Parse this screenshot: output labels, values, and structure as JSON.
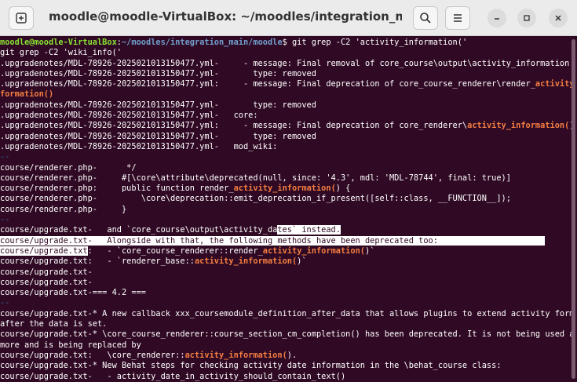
{
  "window": {
    "title": "moodle@moodle-VirtualBox: ~/moodles/integration_main/...",
    "icons": [
      "new-tab-icon",
      "search-icon",
      "menu-icon",
      "minimize-icon",
      "maximize-icon",
      "close-icon"
    ]
  },
  "prompt": {
    "user": "moodle@moodle-VirtualBox",
    "sep": ":",
    "path": "~/moodles/integration_main/moodle",
    "dollar": "$ ",
    "command": "git grep -C2 'activity_information('",
    "wrapped": "git grep -C2 'wiki_info('"
  },
  "lines": [
    {
      "s": [
        {
          "t": ".upgradenotes/MDL-78926-2025021013150477.yml-     - message: Final removal of core_course\\output\\activity_information"
        }
      ]
    },
    {
      "s": [
        {
          "t": ".upgradenotes/MDL-78926-2025021013150477.yml-       type: removed"
        }
      ]
    },
    {
      "s": [
        {
          "t": ".upgradenotes/MDL-78926-2025021013150477.yml:     - message: Final deprecation of core_course_renderer\\render_"
        },
        {
          "t": "activity_in",
          "c": "m"
        }
      ]
    },
    {
      "s": [
        {
          "t": "formation()",
          "c": "m"
        }
      ]
    },
    {
      "s": [
        {
          "t": ".upgradenotes/MDL-78926-2025021013150477.yml-       type: removed"
        }
      ]
    },
    {
      "s": [
        {
          "t": ".upgradenotes/MDL-78926-2025021013150477.yml-   core:"
        }
      ]
    },
    {
      "s": [
        {
          "t": ".upgradenotes/MDL-78926-2025021013150477.yml:     - message: Final deprecation of core_renderer\\"
        },
        {
          "t": "activity_information(",
          "c": "m"
        },
        {
          "t": ")"
        }
      ]
    },
    {
      "s": [
        {
          "t": ".upgradenotes/MDL-78926-2025021013150477.yml-       type: removed"
        }
      ]
    },
    {
      "s": [
        {
          "t": ".upgradenotes/MDL-78926-2025021013150477.yml-   mod_wiki:"
        }
      ]
    },
    {
      "s": [
        {
          "t": "--",
          "c": "sep"
        }
      ]
    },
    {
      "s": [
        {
          "t": "course/renderer.php-      */"
        }
      ]
    },
    {
      "s": [
        {
          "t": "course/renderer.php-     #[\\core\\attribute\\deprecated(null, since: '4.3', mdl: 'MDL-78744', final: true)]"
        }
      ]
    },
    {
      "s": [
        {
          "t": "course/renderer.php:     public function render_"
        },
        {
          "t": "activity_information(",
          "c": "m"
        },
        {
          "t": ") {"
        }
      ]
    },
    {
      "s": [
        {
          "t": "course/renderer.php-         \\core\\deprecation::emit_deprecation_if_present([self::class, __FUNCTION__]);"
        }
      ]
    },
    {
      "s": [
        {
          "t": "course/renderer.php-     }"
        }
      ]
    },
    {
      "s": [
        {
          "t": "--",
          "c": "sep"
        }
      ]
    },
    {
      "s": [
        {
          "t": "course/upgrade.txt-   and `core_course\\output\\activity_da"
        },
        {
          "t": "tes` instead.",
          "c": "sel"
        }
      ]
    },
    {
      "s": [
        {
          "t": "course/upgrade.txt-   Alongside with that, the following methods have been deprecated too:                      ",
          "c": "sel"
        }
      ]
    },
    {
      "s": [
        {
          "t": "course/upgrade.txt",
          "c": "sel"
        },
        {
          "t": ":   - `core_course_renderer::render_"
        },
        {
          "t": "act",
          "c": "m"
        },
        {
          "t": "ivity_information(",
          "c": "m"
        },
        {
          "t": ")`"
        }
      ]
    },
    {
      "s": [
        {
          "t": "course/upgrade.txt:   - `renderer_base::"
        },
        {
          "t": "activity_information(",
          "c": "m"
        },
        {
          "t": ")`"
        }
      ]
    },
    {
      "s": [
        {
          "t": "course/upgrade.txt-"
        }
      ]
    },
    {
      "s": [
        {
          "t": "course/upgrade.txt-"
        }
      ]
    },
    {
      "s": [
        {
          "t": "course/upgrade.txt-=== 4.2 ==="
        }
      ]
    },
    {
      "s": [
        {
          "t": "--",
          "c": "sep"
        }
      ]
    },
    {
      "s": [
        {
          "t": "course/upgrade.txt-* A new callback xxx_coursemodule_definition_after_data that allows plugins to extend activity forms"
        }
      ]
    },
    {
      "s": [
        {
          "t": "after the data is set."
        }
      ]
    },
    {
      "s": [
        {
          "t": "course/upgrade.txt-* \\core_course_renderer::course_section_cm_completion() has been deprecated. It is not being used any"
        }
      ]
    },
    {
      "s": [
        {
          "t": "more and is being replaced by"
        }
      ]
    },
    {
      "s": [
        {
          "t": "course/upgrade.txt:   \\core_renderer::"
        },
        {
          "t": "activity_information(",
          "c": "m"
        },
        {
          "t": ")."
        }
      ]
    },
    {
      "s": [
        {
          "t": "course/upgrade.txt-* New Behat steps for checking activity date information in the \\behat_course class:"
        }
      ]
    },
    {
      "s": [
        {
          "t": "course/upgrade.txt-   - activity_date_in_activity_should_contain_text()"
        }
      ]
    },
    {
      "s": [
        {
          "t": "--",
          "c": "sep"
        }
      ]
    }
  ]
}
